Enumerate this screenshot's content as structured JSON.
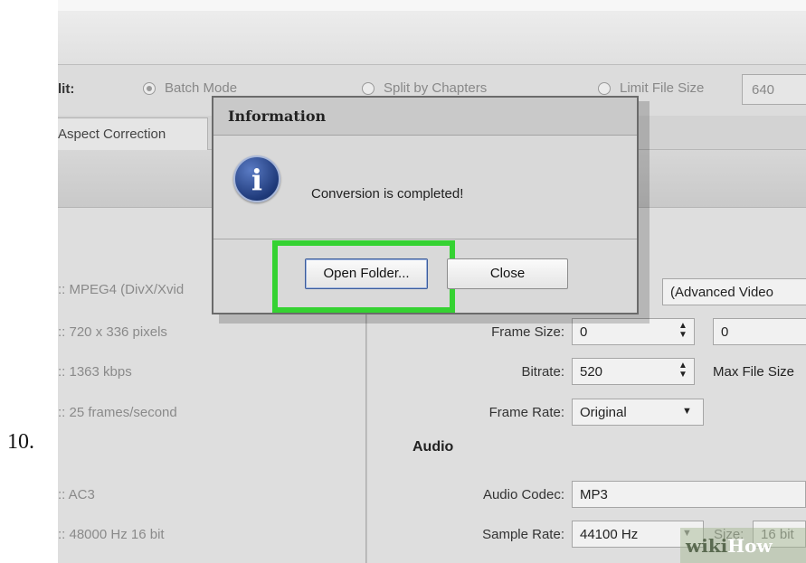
{
  "step_number": "10.",
  "options": {
    "split_label": "lit:",
    "batch_mode": "Batch Mode",
    "split_by_chapters": "Split by Chapters",
    "limit_file_size": "Limit File Size",
    "limit_value": "640"
  },
  "tabs": {
    "aspect_correction": "Aspect Correction"
  },
  "source_info": {
    "codec": ":: MPEG4 (DivX/Xvid",
    "resolution": ":: 720 x 336 pixels",
    "bitrate": ":: 1363 kbps",
    "frame_rate": ":: 25 frames/second",
    "audio_codec": ":: AC3",
    "sample_rate": ":: 48000 Hz 16 bit"
  },
  "video": {
    "codec_value": "(Advanced Video",
    "frame_size_label": "Frame Size:",
    "frame_width": "0",
    "frame_height": "0",
    "bitrate_label": "Bitrate:",
    "bitrate_value": "520",
    "max_file_size_label": "Max File Size",
    "frame_rate_label": "Frame Rate:",
    "frame_rate_value": "Original"
  },
  "audio": {
    "heading": "Audio",
    "codec_label": "Audio Codec:",
    "codec_value": "MP3",
    "sample_rate_label": "Sample Rate:",
    "sample_rate_value": "44100 Hz",
    "size_label": "Size:",
    "size_value": "16 bit"
  },
  "dialog": {
    "title": "Information",
    "message": "Conversion is completed!",
    "open_folder": "Open Folder...",
    "close": "Close"
  },
  "watermark": {
    "wiki": "wiki",
    "how": "How"
  },
  "colors": {
    "highlight": "#35d232",
    "info_icon": "#1f3a7a"
  }
}
